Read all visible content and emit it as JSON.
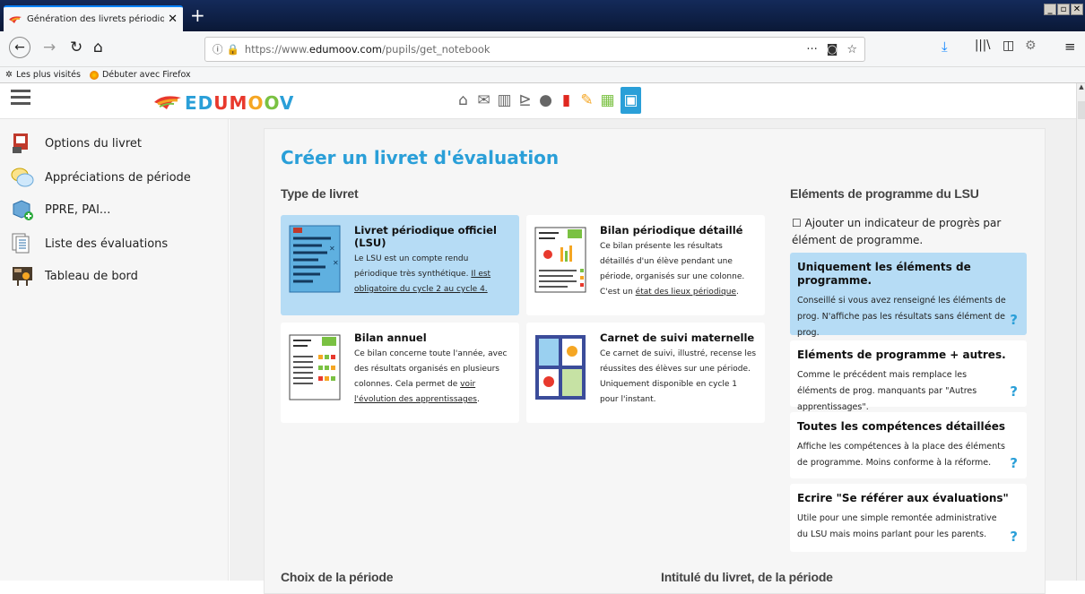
{
  "browser": {
    "tab_title": "Génération des livrets périodiques",
    "tab_close": "✕",
    "new_tab": "+",
    "url_prefix": "https://www.",
    "url_host": "edumoov.com",
    "url_path": "/pupils/get_notebook",
    "bookmarks": [
      "Les plus visités",
      "Débuter avec Firefox"
    ],
    "window_controls": [
      "_",
      "▫",
      "✕"
    ]
  },
  "site": {
    "logo_text": "EDUMOOV",
    "nav_icons": [
      "home-icon",
      "mail-icon",
      "book-icon",
      "cart-icon",
      "user-icon",
      "pdf-icon",
      "pencil-icon",
      "calendar-icon",
      "briefcase-icon"
    ]
  },
  "sidebar": {
    "items": [
      {
        "label": "Options du livret",
        "icon": "notebook-options-icon"
      },
      {
        "label": "Appréciations de période",
        "icon": "speech-bubbles-icon"
      },
      {
        "label": "PPRE, PAI...",
        "icon": "cube-plus-icon"
      },
      {
        "label": "Liste des évaluations",
        "icon": "list-pages-icon"
      },
      {
        "label": "Tableau de bord",
        "icon": "dashboard-icon"
      }
    ]
  },
  "main": {
    "title": "Créer un livret d'évaluation",
    "type_heading": "Type de livret",
    "lsu_heading": "Eléments de programme du LSU",
    "period_heading": "Choix de la période",
    "intitule_heading": "Intitulé du livret, de la période",
    "options": [
      {
        "title": "Livret périodique officiel (LSU)",
        "desc_a": "Le LSU est un compte rendu périodique très synthétique. ",
        "desc_link": "Il est obligatoire du cycle 2 au cycle 4.",
        "desc_b": "",
        "selected": true
      },
      {
        "title": "Bilan périodique détaillé",
        "desc_a": "Ce bilan présente les résultats détaillés d'un élève pendant une période, organisés sur une colonne. C'est un ",
        "desc_link": "état des lieux périodique",
        "desc_b": ".",
        "selected": false
      },
      {
        "title": "Bilan annuel",
        "desc_a": "Ce bilan concerne toute l'année, avec des résultats organisés en plusieurs colonnes. Cela permet de ",
        "desc_link": "voir l'évolution des apprentissages",
        "desc_b": ".",
        "selected": false
      },
      {
        "title": "Carnet de suivi maternelle",
        "desc_a": "Ce carnet de suivi, illustré, recense les réussites des élèves sur une période. Uniquement disponible en cycle 1 pour l'instant.",
        "desc_link": "",
        "desc_b": "",
        "selected": false
      }
    ],
    "lsu_checkbox": "Ajouter un indicateur de progrès par élément de programme.",
    "lsu_options": [
      {
        "title": "Uniquement les éléments de programme.",
        "desc": "Conseillé si vous avez renseigné les éléments de prog. N'affiche pas les résultats sans élément de prog.",
        "selected": true
      },
      {
        "title": "Eléments de programme + autres.",
        "desc": "Comme le précédent mais remplace les éléments de prog. manquants par \"Autres apprentissages\".",
        "selected": false
      },
      {
        "title": "Toutes les compétences détaillées",
        "desc": "Affiche les compétences à la place des éléments de programme. Moins conforme à la réforme.",
        "selected": false
      },
      {
        "title": "Ecrire \"Se référer aux évaluations\"",
        "desc": "Utile pour une simple remontée administrative du LSU mais moins parlant pour les parents.",
        "selected": false
      }
    ],
    "help": "?"
  }
}
